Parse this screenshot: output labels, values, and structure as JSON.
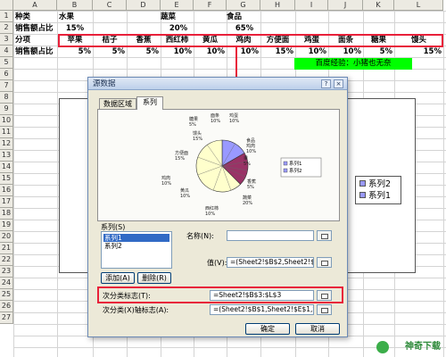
{
  "sheet": {
    "columns": [
      "A",
      "B",
      "C",
      "D",
      "E",
      "F",
      "G",
      "H",
      "I",
      "J",
      "K",
      "L"
    ],
    "rows": [
      "1",
      "2",
      "3",
      "4",
      "5",
      "6",
      "7",
      "8",
      "9",
      "10",
      "11",
      "12",
      "13",
      "14",
      "15",
      "16",
      "17",
      "18",
      "19",
      "20",
      "21",
      "22",
      "23",
      "24",
      "25",
      "26",
      "27"
    ],
    "r1": {
      "a": "种类",
      "b": "水果",
      "e": "蔬菜",
      "g": "食品"
    },
    "r2": {
      "a": "销售额占比",
      "b": "15%",
      "e": "20%",
      "g": "65%"
    },
    "r3": {
      "a": "分项",
      "items": [
        "苹果",
        "桔子",
        "香蕉",
        "西红柿",
        "黄瓜",
        "鸡肉",
        "方便面",
        "鸡蛋",
        "面条",
        "糖果",
        "馒头"
      ]
    },
    "r4": {
      "a": "销售额占比",
      "values": [
        "5%",
        "5%",
        "5%",
        "10%",
        "10%",
        "10%",
        "15%",
        "10%",
        "10%",
        "5%",
        "15%"
      ]
    },
    "banner": "百度经验：小猪也无奈",
    "legend": [
      "系列2",
      "系列1"
    ]
  },
  "dialog": {
    "title": "源数据",
    "help": "?",
    "close": "×",
    "tabs": [
      "数据区域",
      "系列"
    ],
    "pie_labels": [
      {
        "name": "糖果",
        "pct": "5%"
      },
      {
        "name": "面条",
        "pct": "10%"
      },
      {
        "name": "鸡蛋",
        "pct": "10%"
      },
      {
        "name": "食品\n鸡肉",
        "pct": "10%"
      },
      {
        "name": "方便面",
        "pct": "15%"
      },
      {
        "name": "鸡肉",
        "pct": "10%"
      },
      {
        "name": "黄瓜",
        "pct": "10%"
      },
      {
        "name": "西红柿",
        "pct": "10%"
      },
      {
        "name": "蔬菜",
        "pct": "20%"
      },
      {
        "name": "果",
        "pct": "5%"
      },
      {
        "name": "香蕉",
        "pct": "5%"
      },
      {
        "name": "馒头",
        "pct": "15%"
      }
    ],
    "chart_legend": [
      "系列1",
      "系列2"
    ],
    "series_label": "系列(S)",
    "series_items": [
      "系列1",
      "系列2"
    ],
    "name_label": "名称(N):",
    "value_label": "值(V):",
    "value_field": "=(Sheet2!$B$2,Sheet2!$E$",
    "add_button": "添加(A)",
    "delete_button": "删除(R)",
    "category_label": "次分类标志(T):",
    "category_field": "=Sheet2!$B$3:$L$3",
    "secondary_label": "次分类(X)轴标志(A):",
    "secondary_field": "=(Sheet2!$B$1,Sheet2!$E$1,Sh",
    "ok_button": "确定",
    "cancel_button": "取消"
  },
  "watermark": "神奇下载",
  "colors": {
    "highlight": "#e8203a",
    "banner": "#00ff00",
    "pie_main": "#ffffcc",
    "pie_a": "#9999ff",
    "pie_b": "#993366"
  }
}
